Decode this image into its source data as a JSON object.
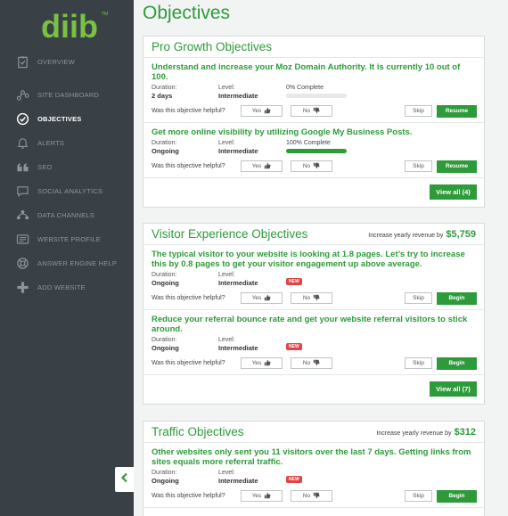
{
  "app": {
    "logo_text": "diib",
    "logo_tm": "TM"
  },
  "sidebar": {
    "items": [
      {
        "label": "OVERVIEW",
        "icon": "clipboard-icon"
      },
      {
        "label": "SITE DASHBOARD",
        "icon": "sitemap-icon"
      },
      {
        "label": "OBJECTIVES",
        "icon": "check-circle-icon",
        "active": true
      },
      {
        "label": "ALERTS",
        "icon": "bell-icon"
      },
      {
        "label": "SEO",
        "icon": "quote-icon"
      },
      {
        "label": "SOCIAL ANALYTICS",
        "icon": "chat-icon"
      },
      {
        "label": "DATA CHANNELS",
        "icon": "channels-icon"
      },
      {
        "label": "WEBSITE PROFILE",
        "icon": "profile-icon"
      },
      {
        "label": "ANSWER ENGINE HELP",
        "icon": "lifebuoy-icon"
      },
      {
        "label": "ADD WEBSITE",
        "icon": "plus-icon"
      }
    ],
    "collapse_icon": "chevron-left-icon"
  },
  "page": {
    "title": "Objectives"
  },
  "labels": {
    "duration": "Duration:",
    "level": "Level:",
    "helpful": "Was this objective helpful?",
    "yes": "Yes",
    "no": "No",
    "skip": "Skip",
    "new": "NEW",
    "increase_prefix": "Increase yearly revenue by"
  },
  "sections": [
    {
      "title": "Pro Growth Objectives",
      "revenue": "",
      "view_all": "View all (4)",
      "objectives": [
        {
          "title": "Understand and increase your Moz Domain Authority. It is currently 10 out of 100.",
          "duration": "2 days",
          "level": "Intermediate",
          "progress_text": "0% Complete",
          "progress": 0,
          "action": "Resume"
        },
        {
          "title": "Get more online visibility by utilizing Google My Business Posts.",
          "duration": "Ongoing",
          "level": "Intermediate",
          "progress_text": "100% Complete",
          "progress": 100,
          "action": "Resume"
        }
      ]
    },
    {
      "title": "Visitor Experience Objectives",
      "revenue": "$5,759",
      "view_all": "View all (7)",
      "objectives": [
        {
          "title": "The typical visitor to your website is looking at 1.8 pages. Let’s try to increase this by 0.8 pages to get your visitor engagement up above average.",
          "duration": "Ongoing",
          "level": "Intermediate",
          "action": "Begin"
        },
        {
          "title": "Reduce your referral bounce rate and get your website referral visitors to stick around.",
          "duration": "Ongoing",
          "level": "Intermediate",
          "action": "Begin"
        }
      ]
    },
    {
      "title": "Traffic Objectives",
      "revenue": "$312",
      "objectives": [
        {
          "title": "Other websites only sent you 11 visitors over the last 7 days. Getting links from sites equals more referral traffic.",
          "duration": "Ongoing",
          "level": "Intermediate",
          "action": "Begin"
        }
      ]
    }
  ],
  "colors": {
    "accent": "#2d9b3a",
    "sidebar": "#3a4146",
    "badge": "#e04545"
  }
}
